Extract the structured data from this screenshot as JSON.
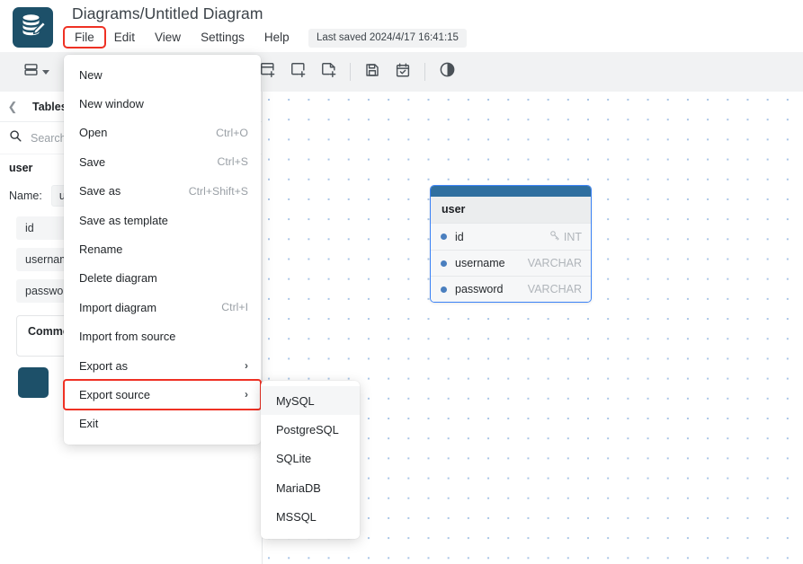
{
  "header": {
    "logo_icon": "database-pencil-icon",
    "title": "Diagrams/Untitled Diagram",
    "saved_status": "Last saved 2024/4/17 16:41:15",
    "menu": [
      {
        "label": "File",
        "highlighted": true
      },
      {
        "label": "Edit",
        "highlighted": false
      },
      {
        "label": "View",
        "highlighted": false
      },
      {
        "label": "Settings",
        "highlighted": false
      },
      {
        "label": "Help",
        "highlighted": false
      }
    ]
  },
  "toolbar": {
    "buttons": [
      {
        "name": "layout-dropdown",
        "icon": "rows-layout-icon"
      },
      {
        "name": "toolbar-overflow",
        "icon": "chevron-right-icon"
      },
      {
        "name": "add-table",
        "icon": "add-table-icon"
      },
      {
        "name": "add-area",
        "icon": "add-area-icon"
      },
      {
        "name": "add-note",
        "icon": "add-note-icon"
      },
      {
        "name": "save",
        "icon": "floppy-save-icon"
      },
      {
        "name": "todo",
        "icon": "calendar-check-icon"
      },
      {
        "name": "theme-toggle",
        "icon": "half-circle-contrast-icon"
      }
    ]
  },
  "sidebar": {
    "collapse_icon": "chevron-left-icon",
    "tab_label": "Tables",
    "search": {
      "icon": "search-icon",
      "placeholder": "Search...",
      "value": ""
    },
    "table": {
      "name": "user",
      "name_label": "Name:",
      "name_value": "user",
      "fields": [
        {
          "name": "id"
        },
        {
          "name": "username"
        },
        {
          "name": "password"
        }
      ],
      "comment_label": "Comment",
      "color": "#1d5069"
    }
  },
  "canvas": {
    "node": {
      "title": "user",
      "fields": [
        {
          "name": "id",
          "type": "INT",
          "key": true,
          "key_icon": "key-icon"
        },
        {
          "name": "username",
          "type": "VARCHAR",
          "key": false
        },
        {
          "name": "password",
          "type": "VARCHAR",
          "key": false
        }
      ]
    }
  },
  "file_menu": {
    "items": [
      {
        "label": "New",
        "shortcut": "",
        "arrow": false,
        "highlighted": false
      },
      {
        "label": "New window",
        "shortcut": "",
        "arrow": false,
        "highlighted": false
      },
      {
        "label": "Open",
        "shortcut": "Ctrl+O",
        "arrow": false,
        "highlighted": false
      },
      {
        "label": "Save",
        "shortcut": "Ctrl+S",
        "arrow": false,
        "highlighted": false
      },
      {
        "label": "Save as",
        "shortcut": "Ctrl+Shift+S",
        "arrow": false,
        "highlighted": false
      },
      {
        "label": "Save as template",
        "shortcut": "",
        "arrow": false,
        "highlighted": false
      },
      {
        "label": "Rename",
        "shortcut": "",
        "arrow": false,
        "highlighted": false
      },
      {
        "label": "Delete diagram",
        "shortcut": "",
        "arrow": false,
        "highlighted": false
      },
      {
        "label": "Import diagram",
        "shortcut": "Ctrl+I",
        "arrow": false,
        "highlighted": false
      },
      {
        "label": "Import from source",
        "shortcut": "",
        "arrow": false,
        "highlighted": false
      },
      {
        "label": "Export as",
        "shortcut": "",
        "arrow": true,
        "highlighted": false
      },
      {
        "label": "Export source",
        "shortcut": "",
        "arrow": true,
        "highlighted": true
      },
      {
        "label": "Exit",
        "shortcut": "",
        "arrow": false,
        "highlighted": false
      }
    ]
  },
  "export_source_submenu": {
    "items": [
      {
        "label": "MySQL",
        "hovered": true
      },
      {
        "label": "PostgreSQL",
        "hovered": false
      },
      {
        "label": "SQLite",
        "hovered": false
      },
      {
        "label": "MariaDB",
        "hovered": false
      },
      {
        "label": "MSSQL",
        "hovered": false
      }
    ]
  },
  "colors": {
    "accent": "#1d5069",
    "highlight_outline": "#ef3124",
    "node_border": "#3b82f6",
    "node_bar": "#2f6f9f",
    "toolbar_bg": "#f1f2f3",
    "grid_dot": "#a8c4e6"
  }
}
